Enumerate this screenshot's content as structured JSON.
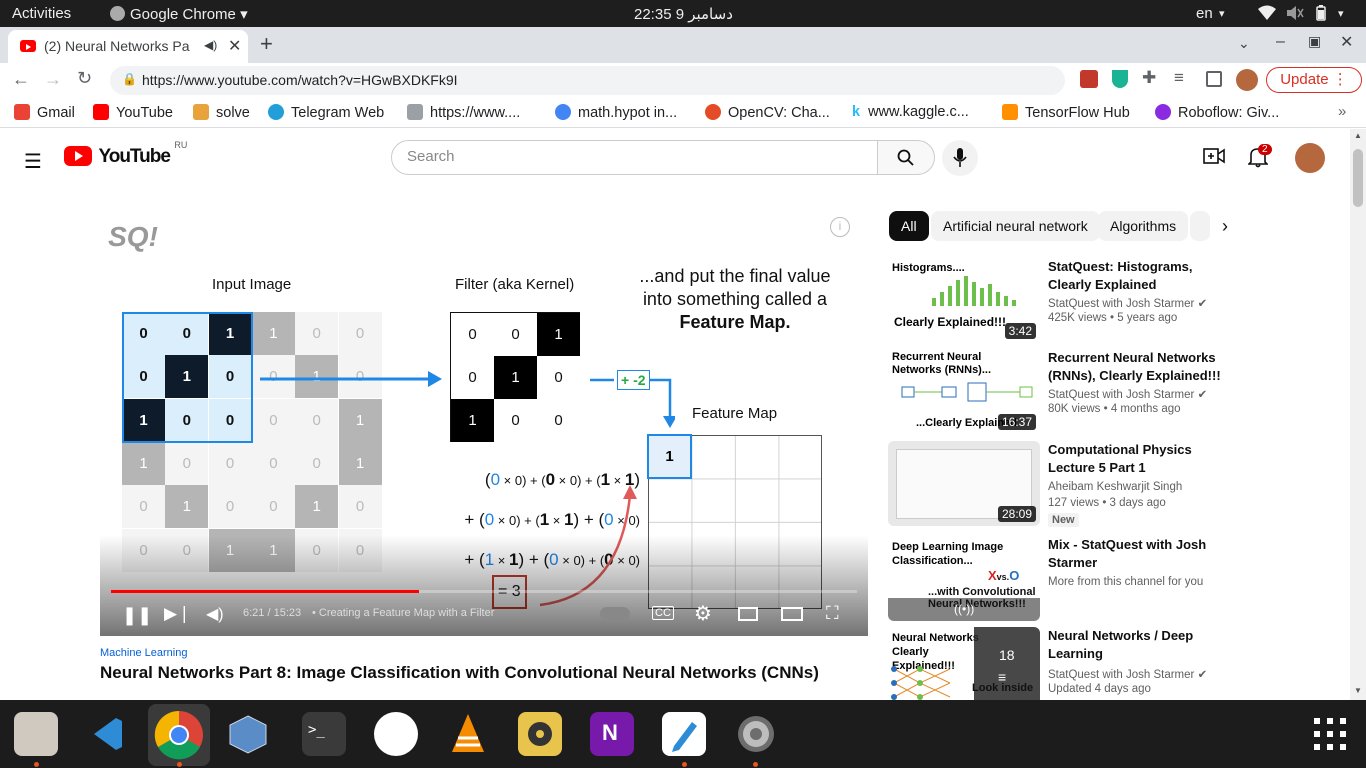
{
  "gnome": {
    "activities": "Activities",
    "app_menu": "Google Chrome",
    "clock": "22:35  9 دسامبر",
    "lang": "en"
  },
  "chrome": {
    "tab_title": "(2) Neural Networks Pa",
    "url": "https://www.youtube.com/watch?v=HGwBXDKFk9I",
    "update_label": "Update",
    "bookmarks": [
      "Gmail",
      "YouTube",
      "solve",
      "Telegram Web",
      "https://www....",
      "math.hypot in...",
      "OpenCV: Cha...",
      "www.kaggle.c...",
      "TensorFlow Hub",
      "Roboflow: Giv..."
    ]
  },
  "youtube": {
    "logo": "YouTube",
    "region": "RU",
    "search_placeholder": "Search",
    "notif_count": "2"
  },
  "video": {
    "input_label": "Input Image",
    "filter_label": "Filter (aka Kernel)",
    "caption_line1": "...and put the final value",
    "caption_line2": "into something called a",
    "caption_bold": "Feature Map",
    "caption_period": ".",
    "featuremap_label": "Feature Map",
    "featuremap_value": "1",
    "bias": "+ -2",
    "equals": "= 3",
    "formula_lines": [
      [
        "(",
        "0",
        " × 0) + (",
        "0",
        " × 0) + (",
        "1",
        " × ",
        "1",
        ")"
      ],
      [
        "+ (",
        "0",
        " × 0) + (",
        "1",
        " × ",
        "1",
        ") + (",
        "0",
        " × 0)"
      ],
      [
        "+ (",
        "1",
        " × ",
        "1",
        ") + (",
        "0",
        " × 0) + (",
        "0",
        " × 0)"
      ]
    ],
    "input_grid": [
      [
        "0",
        "0",
        "1",
        "1",
        "0",
        "0"
      ],
      [
        "0",
        "1",
        "0",
        "0",
        "1",
        "0"
      ],
      [
        "1",
        "0",
        "0",
        "0",
        "0",
        "1"
      ],
      [
        "1",
        "0",
        "0",
        "0",
        "0",
        "1"
      ],
      [
        "0",
        "1",
        "0",
        "0",
        "1",
        "0"
      ],
      [
        "0",
        "0",
        "1",
        "1",
        "0",
        "0"
      ]
    ],
    "filter_grid": [
      [
        "0",
        "0",
        "1"
      ],
      [
        "0",
        "1",
        "0"
      ],
      [
        "1",
        "0",
        "0"
      ]
    ],
    "time": "6:21 / 15:23",
    "chapter": "•  Creating a Feature Map with a Filter",
    "progress": 0.413
  },
  "below_video": {
    "category": "Machine Learning",
    "title": "Neural Networks Part 8: Image Classification with Convolutional Neural Networks (CNNs)"
  },
  "chips": [
    "All",
    "Artificial neural network",
    "Algorithms"
  ],
  "recs": [
    {
      "thumb_top": "Histograms....",
      "thumb_bottom": "Clearly Explained!!!",
      "duration": "3:42",
      "title": "StatQuest: Histograms, Clearly Explained",
      "channel": "StatQuest with Josh Starmer",
      "meta": "425K views  •  5 years ago"
    },
    {
      "thumb_top": "Recurrent Neural Networks (RNNs)...",
      "thumb_bottom": "...Clearly Explained",
      "duration": "16:37",
      "title": "Recurrent Neural Networks (RNNs), Clearly Explained!!!",
      "channel": "StatQuest with Josh Starmer",
      "meta": "80K views  •  4 months ago"
    },
    {
      "duration": "28:09",
      "title": "Computational Physics Lecture 5 Part 1",
      "channel": "Aheibam Keshwarjit Singh",
      "meta": "127 views  •  3 days ago",
      "badge": "New"
    },
    {
      "thumb_top": "Deep Learning Image Classification...",
      "thumb_bottom": "...with Convolutional Neural Networks!!!",
      "title": "Mix - StatQuest with Josh Starmer",
      "channel": "More from this channel for you"
    },
    {
      "thumb_top": "Neural Networks Clearly Explained!!!",
      "thumb_bottom": "Look inside",
      "playlist_count": "18",
      "title": "Neural Networks / Deep Learning",
      "channel": "StatQuest with Josh Starmer",
      "meta": "Updated 4 days ago"
    }
  ]
}
